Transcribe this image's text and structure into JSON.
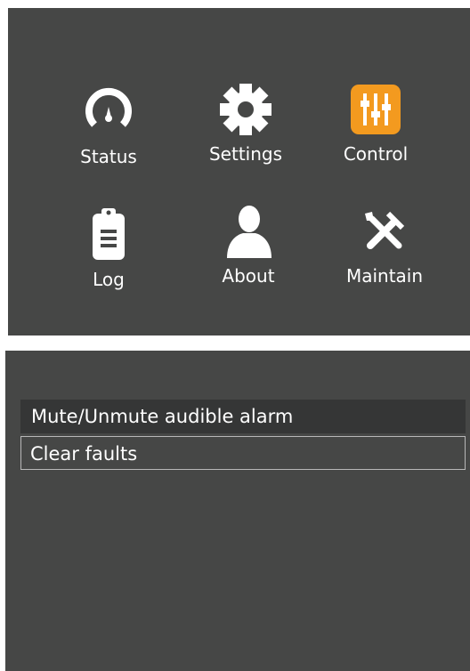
{
  "menu": {
    "tiles": [
      {
        "label": "Status",
        "icon": "gauge-icon"
      },
      {
        "label": "Settings",
        "icon": "gear-icon"
      },
      {
        "label": "Control",
        "icon": "sliders-icon"
      },
      {
        "label": "Log",
        "icon": "clipboard-icon"
      },
      {
        "label": "About",
        "icon": "person-icon"
      },
      {
        "label": "Maintain",
        "icon": "tools-icon"
      }
    ]
  },
  "control": {
    "items": [
      {
        "label": "Mute/Unmute audible alarm",
        "state": "highlighted"
      },
      {
        "label": "Clear faults",
        "state": "selected"
      }
    ]
  },
  "colors": {
    "panel": "#464746",
    "highlight_row": "#353636",
    "accent": "#f39a1f",
    "text": "#ffffff"
  }
}
